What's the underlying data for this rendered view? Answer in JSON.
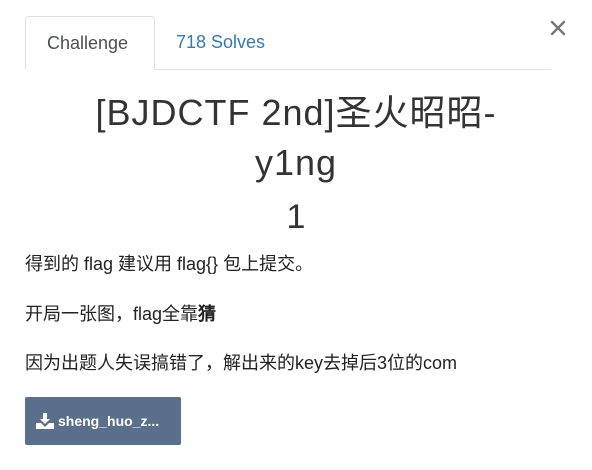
{
  "tabs": {
    "challenge_label": "Challenge",
    "solves_label": "718 Solves"
  },
  "challenge": {
    "title_line1": "[BJDCTF 2nd]圣火昭昭-",
    "title_line2": "y1ng",
    "value": "1"
  },
  "description": {
    "line1": "得到的 flag 建议用 flag{} 包上提交。",
    "line2_prefix": "开局一张图，flag全靠",
    "line2_bold": "猜",
    "line3": "因为出题人失误搞错了，解出来的key去掉后3位的com"
  },
  "file": {
    "label": "sheng_huo_z..."
  },
  "icons": {
    "close": "close-icon",
    "download": "download-icon"
  },
  "colors": {
    "link": "#337ab7",
    "button": "#5a6f8c"
  }
}
